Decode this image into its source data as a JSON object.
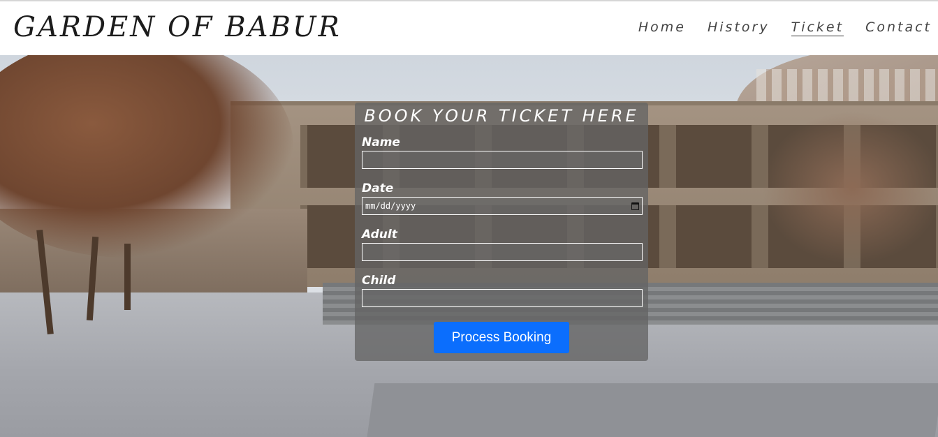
{
  "header": {
    "brand": "GARDEN OF BABUR",
    "nav": [
      {
        "label": "Home",
        "active": false
      },
      {
        "label": "History",
        "active": false
      },
      {
        "label": "Ticket",
        "active": true
      },
      {
        "label": "Contact",
        "active": false
      }
    ]
  },
  "booking": {
    "title": "BOOK YOUR TICKET HERE",
    "fields": {
      "name": {
        "label": "Name",
        "value": ""
      },
      "date": {
        "label": "Date",
        "placeholder": "mm/dd/yyyy",
        "icon": "calendar-icon"
      },
      "adult": {
        "label": "Adult",
        "value": ""
      },
      "child": {
        "label": "Child",
        "value": ""
      }
    },
    "submit_label": "Process Booking",
    "colors": {
      "button": "#0b6efd",
      "panel": "rgba(100,100,100,0.78)"
    }
  }
}
